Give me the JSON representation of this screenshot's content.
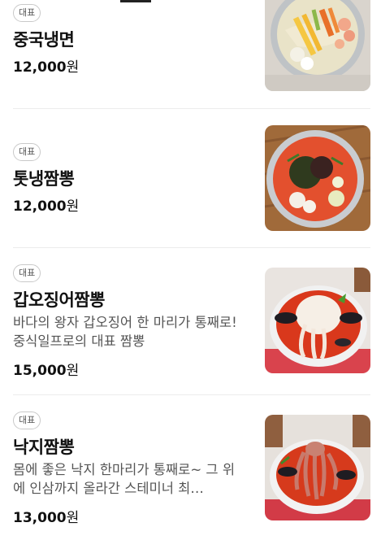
{
  "menu": {
    "items": [
      {
        "badge": "대표",
        "name": "중국냉면",
        "description": "",
        "price": "12,000",
        "currency": "원",
        "image": "cold-noodle-dish-photo"
      },
      {
        "badge": "대표",
        "name": "톳냉짬뽕",
        "description": "",
        "price": "12,000",
        "currency": "원",
        "image": "cold-jjamppong-dish-photo"
      },
      {
        "badge": "대표",
        "name": "갑오징어짬뽕",
        "description": "바다의 왕자 갑오징어 한 마리가 통째로! 중식일프로의 대표 짬뽕",
        "price": "15,000",
        "currency": "원",
        "image": "cuttlefish-jjamppong-photo"
      },
      {
        "badge": "대표",
        "name": "낙지짬뽕",
        "description": "몸에 좋은 낙지 한마리가 통째로~ 그 위에 인삼까지 올라간 스테미너 최…",
        "price": "13,000",
        "currency": "원",
        "image": "octopus-jjamppong-photo"
      }
    ]
  }
}
